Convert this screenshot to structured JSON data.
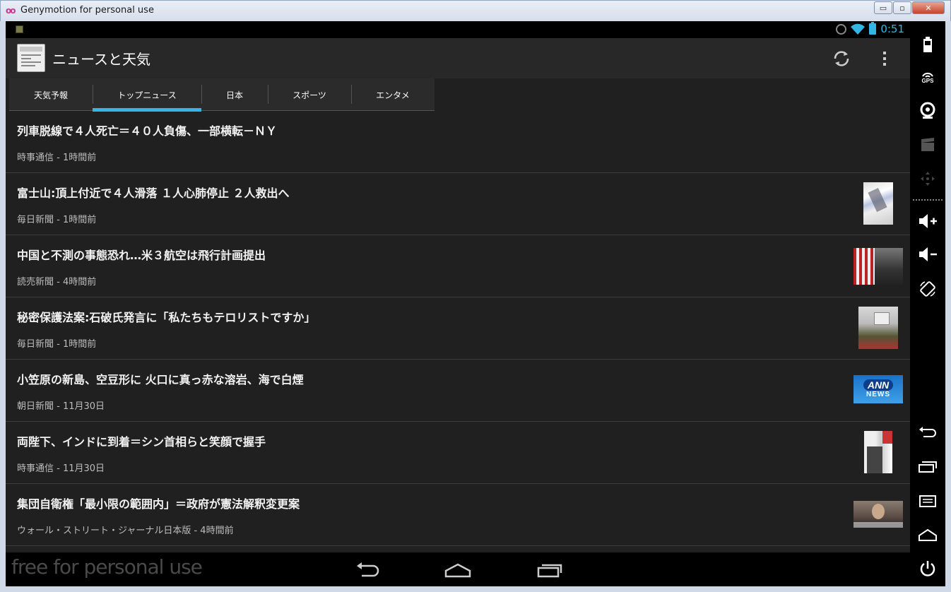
{
  "window": {
    "title": "Genymotion for personal use",
    "controls": {
      "minimize": "▭",
      "maximize": "▫",
      "close": "✕"
    }
  },
  "statusbar": {
    "time": "0:51"
  },
  "actionbar": {
    "title": "ニュースと天気"
  },
  "tabs": [
    {
      "label": "天気予報"
    },
    {
      "label": "トップニュース",
      "active": true
    },
    {
      "label": "日本"
    },
    {
      "label": "スポーツ"
    },
    {
      "label": "エンタメ"
    }
  ],
  "articles": [
    {
      "title": "列車脱線で４人死亡＝４０人負傷、一部横転－ＮＹ",
      "source": "時事通信 - 1時間前"
    },
    {
      "title": "富士山:頂上付近で４人滑落 １人心肺停止 ２人救出へ",
      "source": "毎日新聞 - 1時間前"
    },
    {
      "title": "中国と不測の事態恐れ…米３航空は飛行計画提出",
      "source": "読売新聞 - 4時間前"
    },
    {
      "title": "秘密保護法案:石破氏発言に「私たちもテロリストですか」",
      "source": "毎日新聞 - 1時間前"
    },
    {
      "title": "小笠原の新島、空豆形に 火口に真っ赤な溶岩、海で白煙",
      "source": "朝日新聞 - 11月30日",
      "thumb_text": [
        "ANN",
        "NEWS"
      ]
    },
    {
      "title": "両陛下、インドに到着＝シン首相らと笑顔で握手",
      "source": "時事通信 - 11月30日"
    },
    {
      "title": "集団自衛権「最小限の範囲内」＝政府が憲法解釈変更案",
      "source": "ウォール・ストリート・ジャーナル日本版 - 4時間前"
    }
  ],
  "navbar": {
    "watermark": "free for personal use"
  },
  "toolbar": {
    "gps_label": "GPS"
  },
  "colors": {
    "accent": "#33b5e5",
    "background": "#202020",
    "actionbar": "#282828"
  }
}
